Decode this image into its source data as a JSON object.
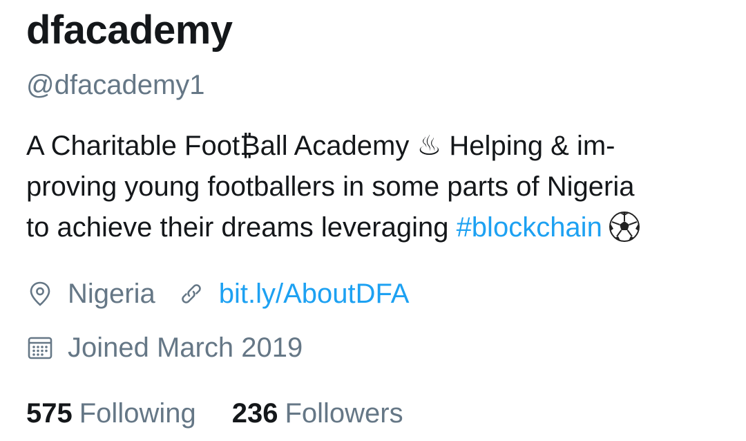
{
  "profile": {
    "display_name": "dfacademy",
    "handle": "@dfacademy1",
    "bio": {
      "line_1": "A Charitable Foot₿all Academy ♨ Helping & im-",
      "line_2": "proving young footballers in some parts of Nigeria",
      "line_3_prefix": "to achieve their dreams leveraging ",
      "hashtag": "#blockchain",
      "emoji_icon": "soccer-ball-icon"
    },
    "location": {
      "icon": "location-pin-icon",
      "text": "Nigeria"
    },
    "website": {
      "icon": "link-icon",
      "text": "bit.ly/AboutDFA"
    },
    "joined": {
      "icon": "calendar-icon",
      "text": "Joined March 2019"
    },
    "following": {
      "count": "575",
      "label": "Following"
    },
    "followers": {
      "count": "236",
      "label": "Followers"
    }
  },
  "colors": {
    "text_primary": "#14171a",
    "text_secondary": "#657786",
    "accent": "#1da1f2"
  }
}
